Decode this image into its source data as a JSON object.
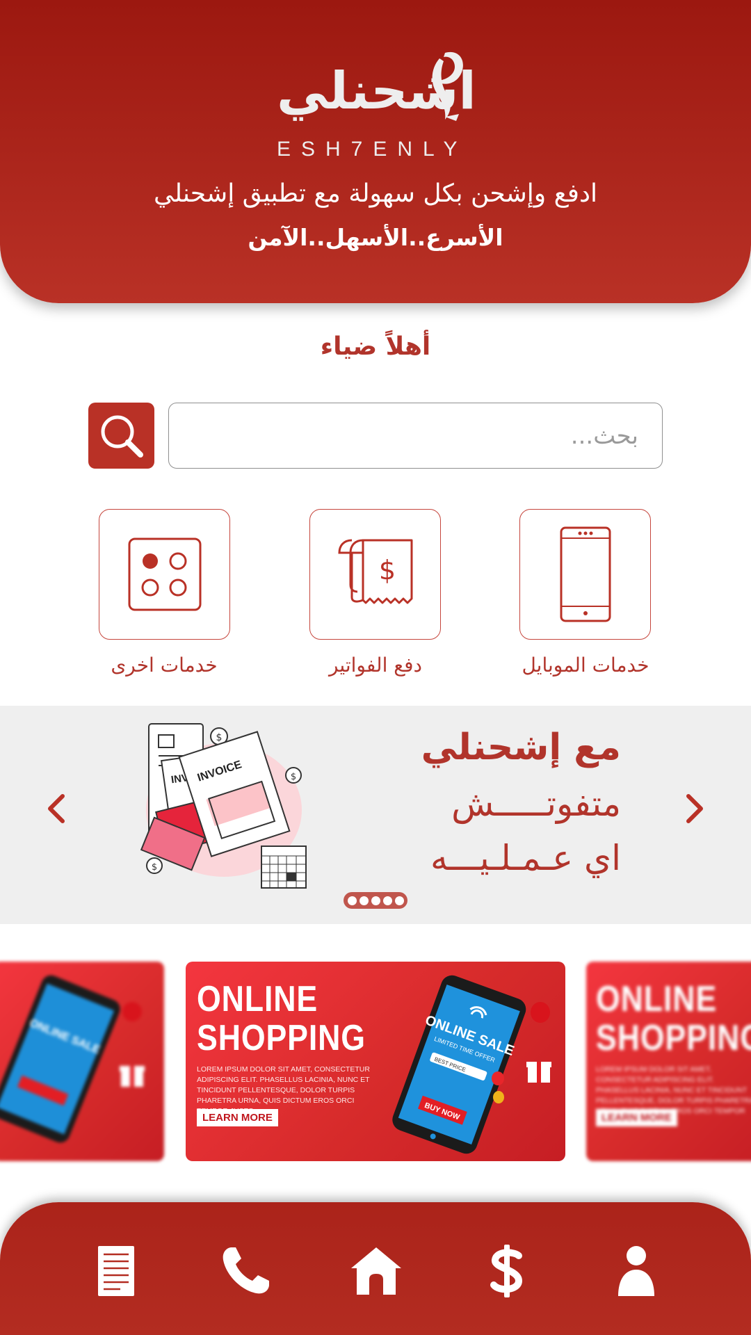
{
  "header": {
    "logo_text_ar": "اشحنلي",
    "logo_text_en": "ESH7ENLY",
    "tagline": "ادفع وإشحن بكل سهولة مع تطبيق إشحنلي",
    "tagline_bold": "الأسرع..الأسهل..الآمن"
  },
  "greeting": "أهلاً ضياء",
  "search": {
    "placeholder": "بحث..."
  },
  "services": [
    {
      "label": "خدمات الموبايل",
      "icon": "mobile-icon"
    },
    {
      "label": "دفع الفواتير",
      "icon": "bill-icon"
    },
    {
      "label": "خدمات اخرى",
      "icon": "more-services-icon"
    }
  ],
  "slider": {
    "title": "مع إشحنلي",
    "line1": "متفوتـــــش",
    "line2": "اي عـمـلـيـــه",
    "illustration_text_1": "INVOICE",
    "illustration_text_2": "INVOICE",
    "dots_count": 5
  },
  "banners": [
    {
      "title_line1": "ONLINE",
      "title_line2": "SHOPPING",
      "body": "LOREM IPSUM DOLOR SIT AMET, CONSECTETUR ADIPISCING ELIT. PHASELLUS LACINIA, NUNC ET TINCIDUNT PELLENTESQUE, DOLOR TURPIS PHARETRA URNA, QUIS DICTUM EROS ORCI TEMPOR JUSTO.",
      "button": "LEARN MORE",
      "phone_title": "ONLINE SALE",
      "phone_subtitle": "LIMITED TIME OFFER",
      "phone_field": "BEST PRICE",
      "phone_button": "BUY NOW"
    }
  ],
  "bottom_nav": [
    {
      "name": "invoices",
      "icon": "document-icon"
    },
    {
      "name": "call",
      "icon": "phone-icon"
    },
    {
      "name": "home",
      "icon": "home-icon"
    },
    {
      "name": "payments",
      "icon": "dollar-icon"
    },
    {
      "name": "profile",
      "icon": "user-icon"
    }
  ],
  "colors": {
    "primary": "#b93126",
    "primary_dark": "#9c1810",
    "text_accent": "#b1342b",
    "slider_bg": "#efefef",
    "banner_red": "#e0302f"
  }
}
